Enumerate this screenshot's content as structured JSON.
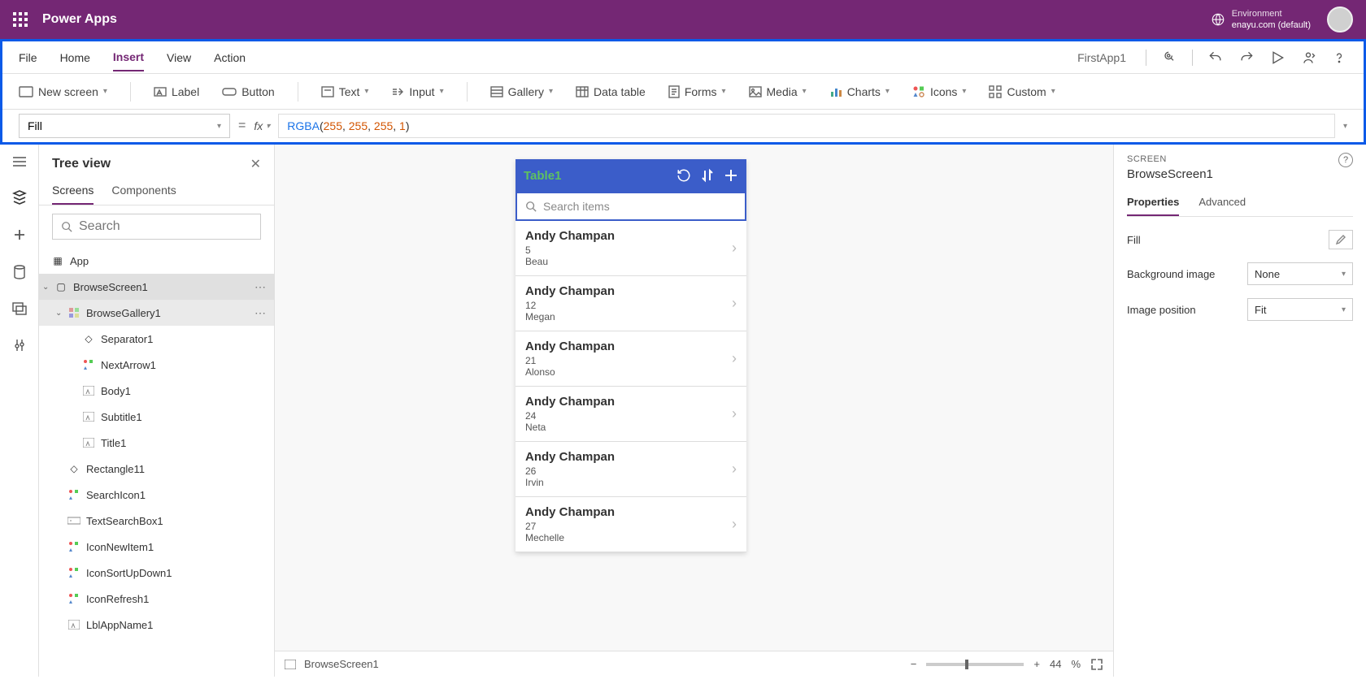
{
  "header": {
    "title": "Power Apps",
    "env_label": "Environment",
    "env_value": "enayu.com (default)"
  },
  "menubar": {
    "items": [
      "File",
      "Home",
      "Insert",
      "View",
      "Action"
    ],
    "active": 2,
    "appname": "FirstApp1"
  },
  "ribbon": {
    "newscreen": "New screen",
    "label": "Label",
    "button": "Button",
    "text": "Text",
    "input": "Input",
    "gallery": "Gallery",
    "datatable": "Data table",
    "forms": "Forms",
    "media": "Media",
    "charts": "Charts",
    "icons": "Icons",
    "custom": "Custom"
  },
  "formula": {
    "property": "Fill",
    "fx": "fx",
    "fn": "RGBA",
    "args": [
      "255",
      "255",
      "255",
      "1"
    ]
  },
  "tree": {
    "title": "Tree view",
    "tabs": [
      "Screens",
      "Components"
    ],
    "activeTab": 0,
    "searchPlaceholder": "Search",
    "nodes": {
      "app": "App",
      "browsescreen": "BrowseScreen1",
      "browsegallery": "BrowseGallery1",
      "separator": "Separator1",
      "nextarrow": "NextArrow1",
      "body": "Body1",
      "subtitle": "Subtitle1",
      "title": "Title1",
      "rectangle": "Rectangle11",
      "searchicon": "SearchIcon1",
      "textsearchbox": "TextSearchBox1",
      "iconnewitem": "IconNewItem1",
      "iconsortupdown": "IconSortUpDown1",
      "iconrefresh": "IconRefresh1",
      "lblappname": "LblAppName1"
    }
  },
  "phone": {
    "title": "Table1",
    "searchPlaceholder": "Search items",
    "items": [
      {
        "title": "Andy Champan",
        "num": "5",
        "body": "Beau"
      },
      {
        "title": "Andy Champan",
        "num": "12",
        "body": "Megan"
      },
      {
        "title": "Andy Champan",
        "num": "21",
        "body": "Alonso"
      },
      {
        "title": "Andy Champan",
        "num": "24",
        "body": "Neta"
      },
      {
        "title": "Andy Champan",
        "num": "26",
        "body": "Irvin"
      },
      {
        "title": "Andy Champan",
        "num": "27",
        "body": "Mechelle"
      }
    ]
  },
  "status": {
    "screen": "BrowseScreen1",
    "zoom": "44",
    "pct": "%"
  },
  "props": {
    "section": "SCREEN",
    "name": "BrowseScreen1",
    "tabs": [
      "Properties",
      "Advanced"
    ],
    "activeTab": 0,
    "rows": {
      "fill": "Fill",
      "bgimg": "Background image",
      "bgimg_val": "None",
      "imgpos": "Image position",
      "imgpos_val": "Fit"
    }
  }
}
